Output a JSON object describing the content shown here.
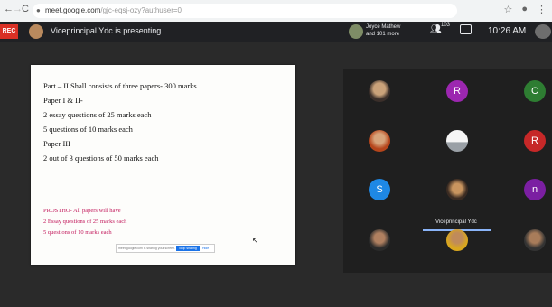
{
  "browser": {
    "url_host": "meet.google.com",
    "url_path": "/gjc-eqsj-ozy?authuser=0",
    "nav_back": "←",
    "nav_forward": "→",
    "nav_reload": "C",
    "star_icon": "☆",
    "extensions_icon": "●",
    "menu_icon": "⋮"
  },
  "meet": {
    "rec_label": "REC",
    "presenting_text": "Viceprincipal Ydc is presenting",
    "joined_line1": "Joyce Mathew",
    "joined_line2": "and 101 more",
    "people_count": "103",
    "time": "10:26 AM",
    "self_label": "Y"
  },
  "slide": {
    "lines": [
      "Part – II  Shall consists of three papers- 300 marks",
      "Paper I & II-",
      "2 essay questions of  25 marks each",
      "5 questions of 10 marks each",
      "Paper III",
      "2 out of 3 questions of 50 marks each"
    ],
    "pink_lines": [
      "PROSTHO- All papers will have",
      "2 Essay questions of 25 marks each",
      "5 questions of 10 marks each"
    ],
    "share_bar_text": "meet.google.com is sharing your screen.",
    "share_stop": "Stop sharing",
    "share_hide": "Hide"
  },
  "participants": {
    "tile_r1": "R",
    "tile_c": "C",
    "tile_r2": "R",
    "tile_s": "S",
    "tile_n": "n",
    "speaker_name": "Viceprincipal Ydc",
    "colors": {
      "r1": "#9c27b0",
      "c": "#2e7d32",
      "r2": "#c62828",
      "s": "#1e88e5",
      "n": "#7b1fa2"
    }
  }
}
